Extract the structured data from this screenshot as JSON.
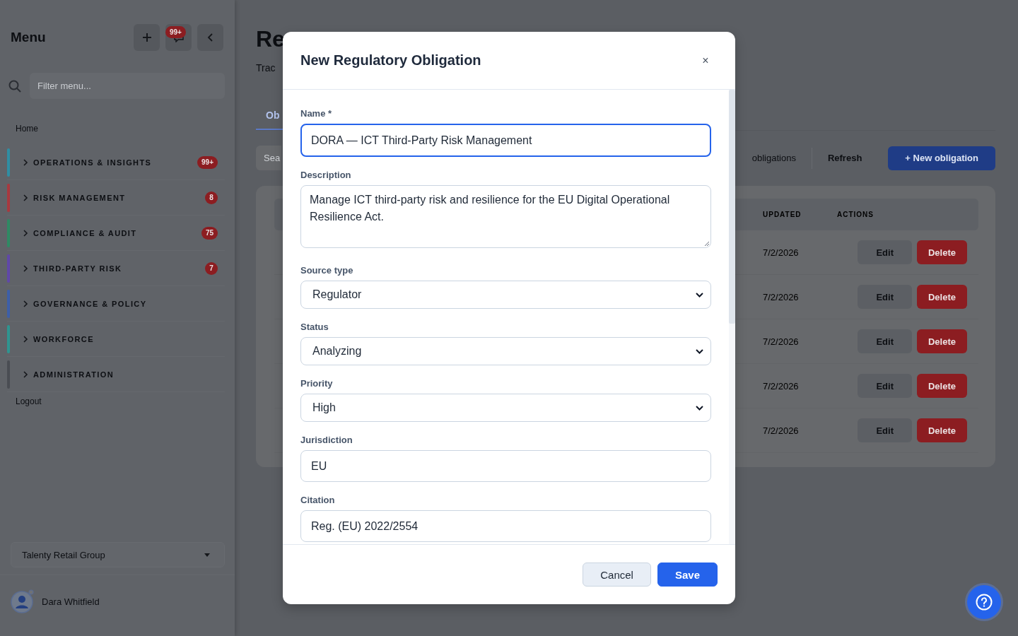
{
  "sidebar": {
    "title": "Menu",
    "notification_badge": "99+",
    "filter": {
      "placeholder": "Filter menu..."
    },
    "home": "Home",
    "groups": [
      {
        "label": "OPERATIONS & INSIGHTS",
        "color": "#2f8ea3",
        "badge": "99+",
        "expanded": false
      },
      {
        "label": "RISK MANAGEMENT",
        "color": "#a8393f",
        "badge": "8",
        "expanded": false
      },
      {
        "label": "COMPLIANCE & AUDIT",
        "color": "#2f8a64",
        "badge": "75",
        "expanded": false
      },
      {
        "label": "THIRD-PARTY RISK",
        "color": "#6048a8",
        "badge": "7",
        "expanded": false
      },
      {
        "label": "GOVERNANCE & POLICY",
        "color": "#3d5fa8",
        "expanded": false
      },
      {
        "label": "WORKFORCE",
        "color": "#2e9590",
        "expanded": false
      },
      {
        "label": "ADMINISTRATION",
        "color": "#4a4d53",
        "expanded": false
      }
    ],
    "logout": "Logout",
    "organization": "Talenty Retail Group",
    "user": "Dara Whitfield"
  },
  "page": {
    "title": "Re",
    "subtitle": "Trac",
    "tabs": [
      {
        "label": "Ob",
        "selected": true
      }
    ],
    "search": {
      "placeholder": "Sea"
    },
    "toolbar": [
      {
        "label": "obligations",
        "kind": "ghost"
      },
      {
        "label": "Refresh",
        "kind": "ghost"
      },
      {
        "label": "+ New obligation",
        "kind": "primary"
      }
    ],
    "table": {
      "columns": [
        "UPDATED",
        "ACTIONS"
      ],
      "rows": [
        {
          "updated": "7/2/2026",
          "actions": [
            {
              "label": "Edit",
              "kind": "secondary"
            },
            {
              "label": "Delete",
              "kind": "danger"
            }
          ]
        },
        {
          "updated": "7/2/2026",
          "actions": [
            {
              "label": "Edit",
              "kind": "secondary"
            },
            {
              "label": "Delete",
              "kind": "danger"
            }
          ]
        },
        {
          "updated": "7/2/2026",
          "actions": [
            {
              "label": "Edit",
              "kind": "secondary"
            },
            {
              "label": "Delete",
              "kind": "danger"
            }
          ]
        },
        {
          "updated": "7/2/2026",
          "actions": [
            {
              "label": "Edit",
              "kind": "secondary"
            },
            {
              "label": "Delete",
              "kind": "danger"
            }
          ]
        },
        {
          "updated": "7/2/2026",
          "actions": [
            {
              "label": "Edit",
              "kind": "secondary"
            },
            {
              "label": "Delete",
              "kind": "danger"
            }
          ]
        }
      ]
    }
  },
  "modal": {
    "title": "New Regulatory Obligation",
    "close": "×",
    "fields": [
      {
        "label": "Name *",
        "kind": "text",
        "value": "DORA — ICT Third-Party Risk Management",
        "focused": true
      },
      {
        "label": "Description",
        "kind": "textarea",
        "value": "Manage ICT third-party risk and resilience for the EU Digital Operational Resilience Act.",
        "focused": false
      },
      {
        "label": "Source type",
        "kind": "select",
        "value": "Regulator",
        "focused": false
      },
      {
        "label": "Status",
        "kind": "select",
        "value": "Analyzing",
        "focused": false
      },
      {
        "label": "Priority",
        "kind": "select",
        "value": "High",
        "focused": false
      },
      {
        "label": "Jurisdiction",
        "kind": "text",
        "value": "EU",
        "focused": false
      },
      {
        "label": "Citation",
        "kind": "text",
        "value": "Reg. (EU) 2022/2554",
        "focused": false
      }
    ],
    "buttons": [
      {
        "label": "Cancel",
        "kind": "secondary"
      },
      {
        "label": "Save",
        "kind": "primary"
      }
    ]
  }
}
